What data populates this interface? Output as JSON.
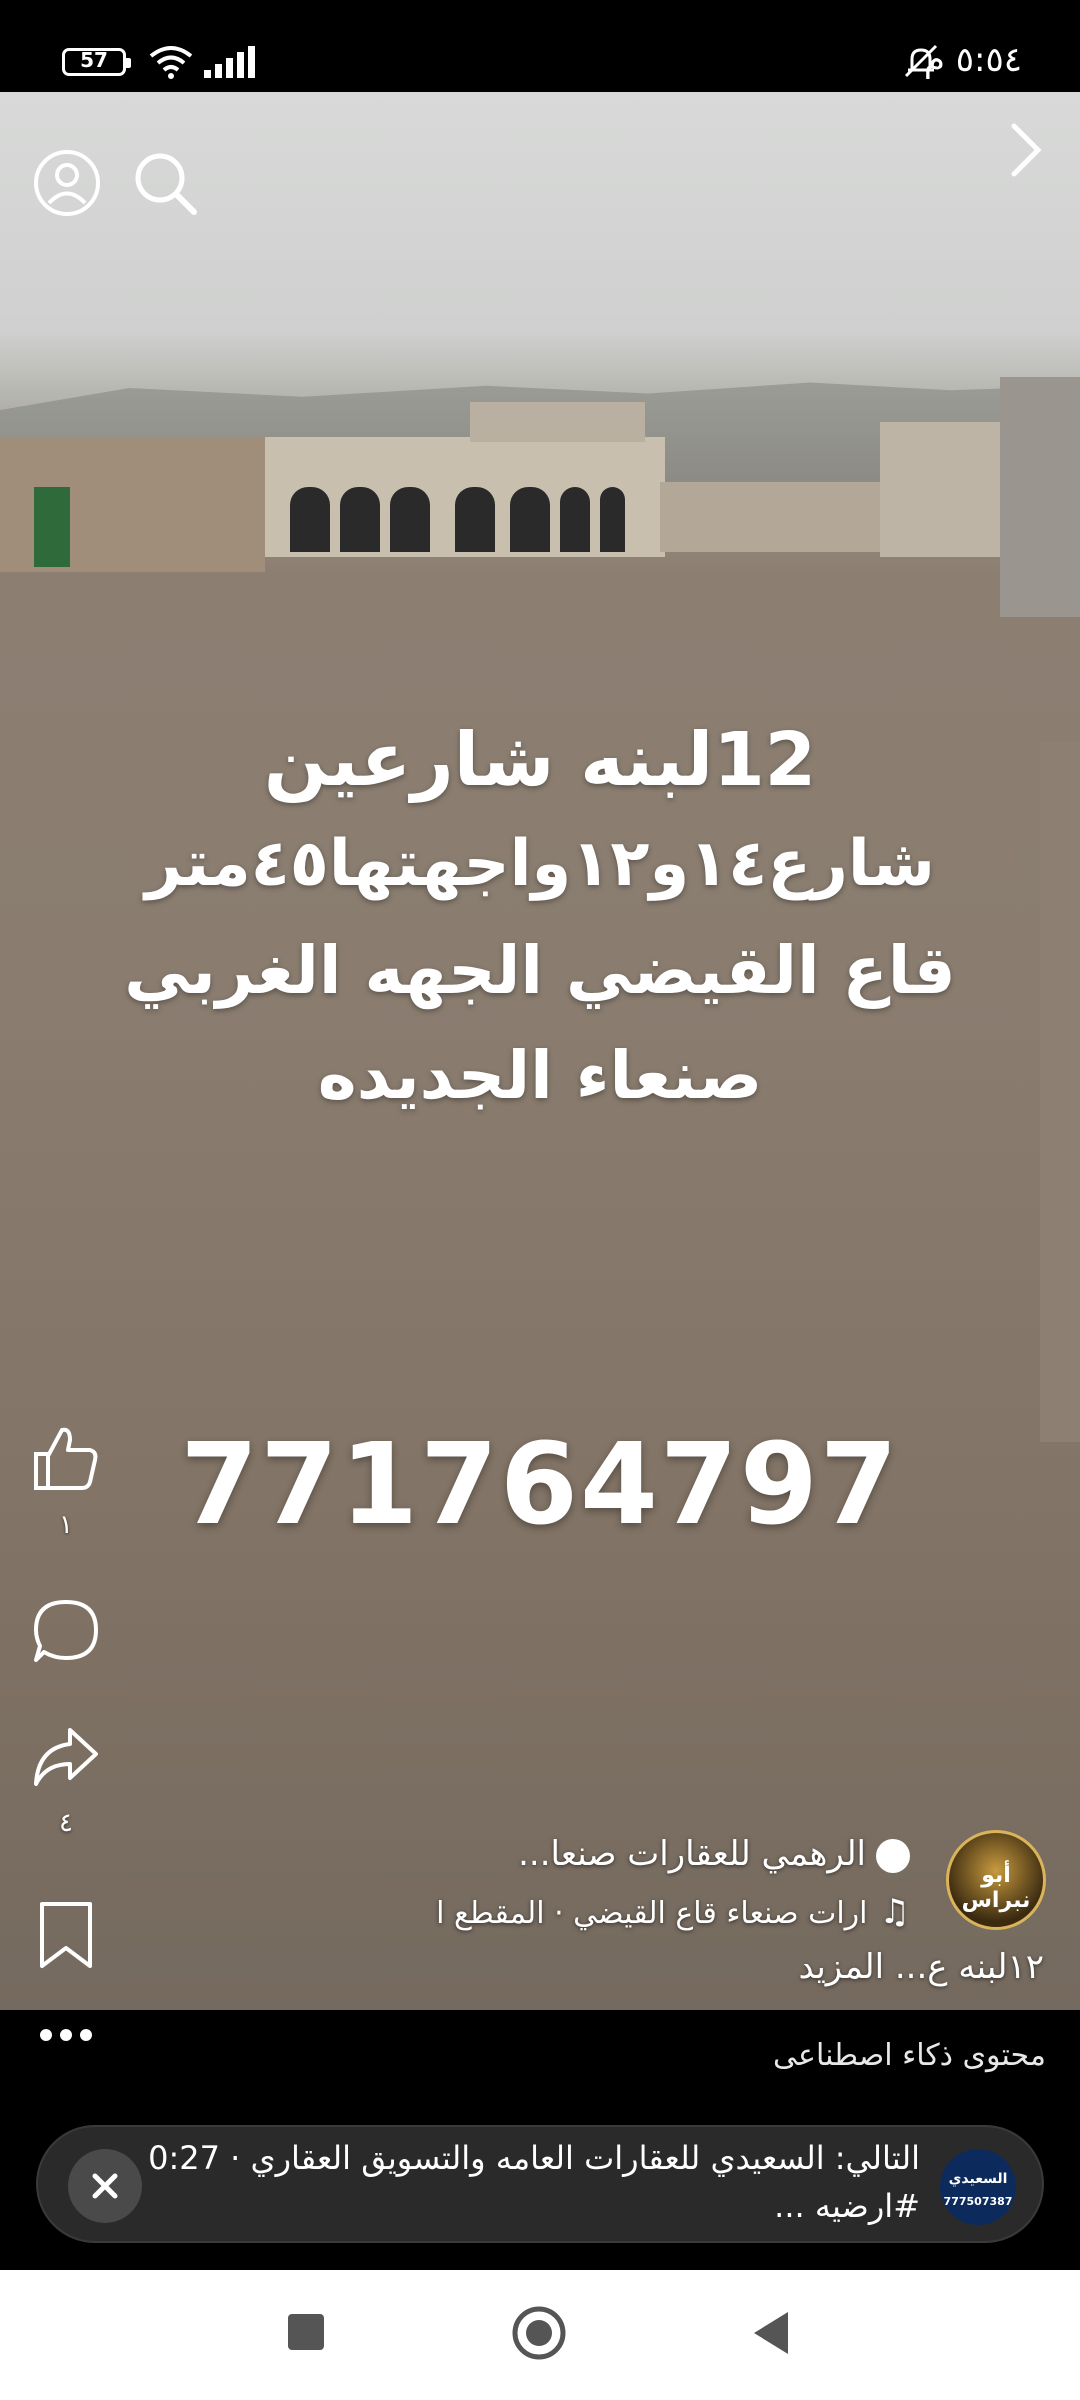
{
  "status_bar": {
    "battery": "57",
    "time": "٥:٥٤ م",
    "icons": [
      "wifi-icon",
      "signal-icon",
      "mute-icon"
    ]
  },
  "top_bar": {
    "icons": [
      "profile-icon",
      "search-icon",
      "chevron-right-icon"
    ]
  },
  "video": {
    "overlay_lines": [
      "12لبنه شارعين",
      "شارع١٤و١٢واجهتها٤٥متر",
      "قاع القيضي الجهه الغربي",
      "صنعاء الجديده"
    ],
    "phone": "771764797"
  },
  "actions": {
    "like_count": "١",
    "comment_icon": "comment-icon",
    "share_count": "٤",
    "save_icon": "bookmark-icon"
  },
  "channel": {
    "name": "الرهمي للعقارات صنعا...",
    "audio": "ارات صنعاء قاع القيضي · المقطع ا",
    "avatar_text": "أبو نبراس",
    "caption": "١٢لبنه ع... المزيد"
  },
  "ai_notice": "محتوى ذكاء اصطناعى",
  "up_next": {
    "line1": "التالي: السعيدي للعقارات العامه والتسويق العقاري · 0:27",
    "line2": "#ارضيه ...",
    "thumb_name": "السعيدي",
    "thumb_phone": "777507387"
  },
  "nav": {
    "icons": [
      "recents-icon",
      "home-icon",
      "back-icon"
    ]
  },
  "colors": {
    "accent": "#ffffff",
    "card": "#2a2a2a"
  }
}
